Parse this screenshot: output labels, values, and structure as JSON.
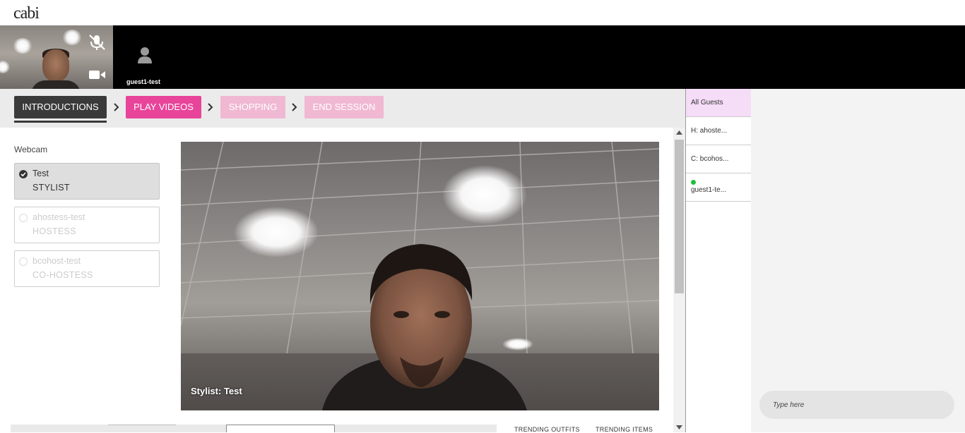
{
  "app": {
    "logo": "cabi"
  },
  "video_strip": {
    "guest_tile": {
      "name": "guest1-test"
    }
  },
  "steps": [
    {
      "label": "INTRODUCTIONS"
    },
    {
      "label": "PLAY VIDEOS"
    },
    {
      "label": "SHOPPING"
    },
    {
      "label": "END SESSION"
    }
  ],
  "webcam": {
    "label": "Webcam",
    "people": [
      {
        "name": "Test",
        "role": "STYLIST",
        "selected": true
      },
      {
        "name": "ahostess-test",
        "role": "HOSTESS",
        "selected": false
      },
      {
        "name": "bcohost-test",
        "role": "CO-HOSTESS",
        "selected": false
      }
    ]
  },
  "main_video": {
    "caption": "Stylist: Test"
  },
  "trending": {
    "outfits_label": "TRENDING OUTFITS",
    "items_label": "TRENDING ITEMS"
  },
  "guests_panel": {
    "items": [
      {
        "label": "All Guests"
      },
      {
        "label": "H: ahoste..."
      },
      {
        "label": "C: bcohos..."
      },
      {
        "label": "guest1-te..."
      }
    ]
  },
  "chat": {
    "placeholder": "Type here"
  },
  "colors": {
    "accent_pink": "#e8449a",
    "step_disabled": "#f0b8d2",
    "step_active": "#3a3a3a",
    "online": "#1fbf3a",
    "guest_selected_bg": "#f5dcf7"
  },
  "icons": {
    "mic": "mic-off-icon",
    "camera": "video-camera-icon",
    "guest": "user-icon",
    "chevron": "chevron-right-icon",
    "check": "check-circle-icon"
  }
}
